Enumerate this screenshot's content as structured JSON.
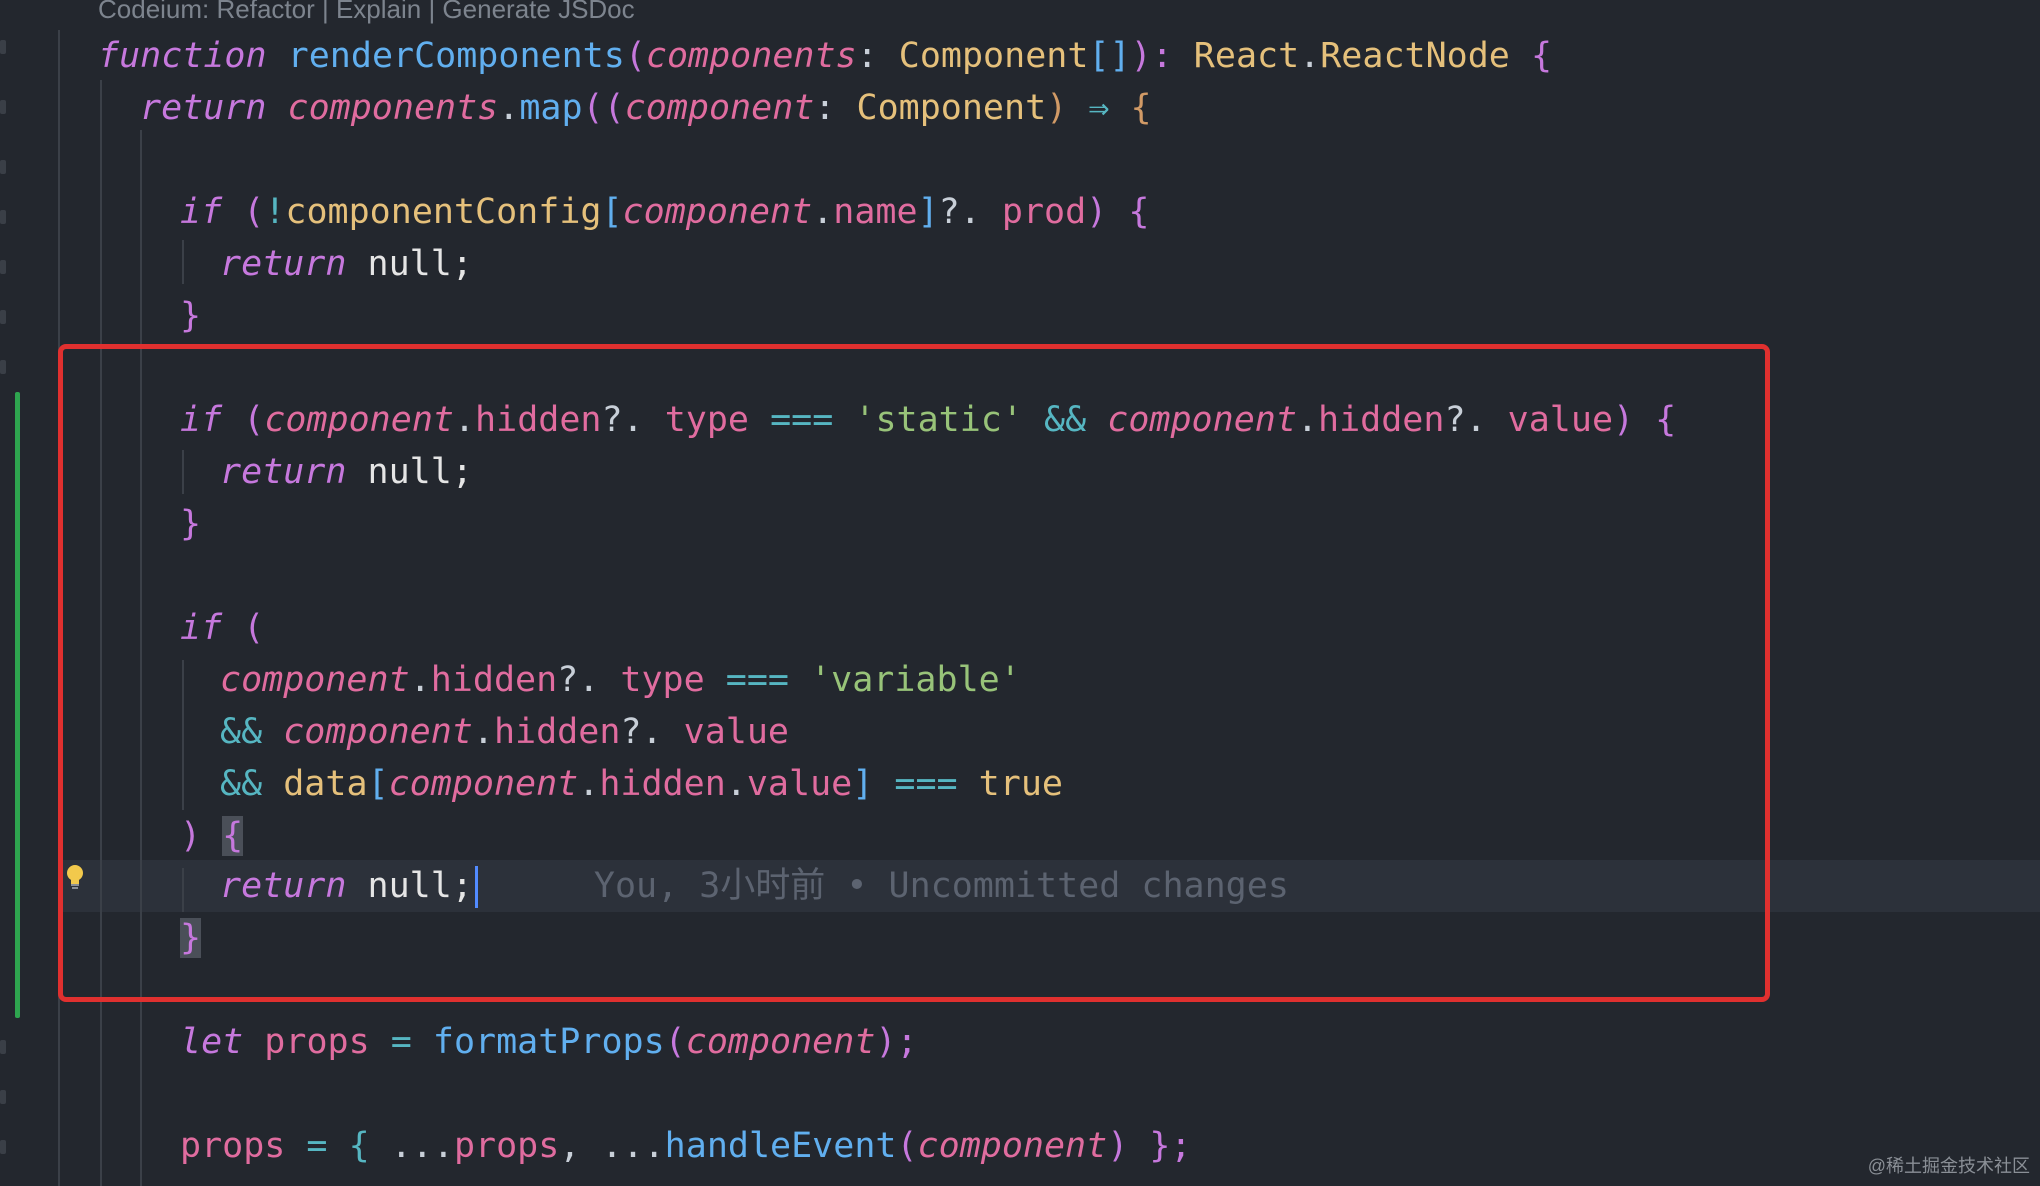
{
  "codelens": "Codeium: Refactor | Explain | Generate JSDoc",
  "blame": "You, 3小时前 • Uncommitted changes",
  "watermark": "@稀土掘金技术社区",
  "icons": {
    "lightbulb": "lightbulb-icon"
  },
  "colors": {
    "background": "#23272e",
    "highlight_box": "#e0302f",
    "change_bar": "#2ea44f",
    "caret": "#528bff"
  },
  "code": {
    "l1": [
      "function",
      "renderComponents",
      "(",
      "components",
      ": ",
      "Component",
      "[]",
      "): ",
      "React",
      ".",
      "ReactNode",
      " {"
    ],
    "l2": [
      "return",
      "components",
      ".",
      "map",
      "((",
      "component",
      ": ",
      "Component",
      ") ",
      "⇒",
      " {"
    ],
    "l4": [
      "if",
      " (",
      "!",
      "componentConfig",
      "[",
      "component",
      ".",
      "name",
      "]",
      "?.",
      " prod",
      ") {"
    ],
    "l5": [
      "return",
      " null;"
    ],
    "l6": [
      "}"
    ],
    "l8": [
      "if",
      " (",
      "component",
      ".",
      "hidden",
      "?.",
      " type",
      " ",
      "===",
      " ",
      "'static'",
      " ",
      "&&",
      " ",
      "component",
      ".",
      "hidden",
      "?.",
      " value",
      ") {"
    ],
    "l9": [
      "return",
      " null;"
    ],
    "l10": [
      "}"
    ],
    "l12": [
      "if",
      " ("
    ],
    "l13": [
      "component",
      ".",
      "hidden",
      "?.",
      " type",
      " ",
      "===",
      " ",
      "'variable'"
    ],
    "l14": [
      "&&",
      " ",
      "component",
      ".",
      "hidden",
      "?.",
      " value"
    ],
    "l15": [
      "&&",
      " ",
      "data",
      "[",
      "component",
      ".",
      "hidden",
      ".",
      "value",
      "]",
      " ",
      "===",
      " ",
      "true"
    ],
    "l16": [
      ")",
      " ",
      "{"
    ],
    "l17": [
      "return",
      " null;"
    ],
    "l18": [
      "}"
    ],
    "l20": [
      "let",
      " ",
      "props",
      " = ",
      "formatProps",
      "(",
      "component",
      ");"
    ],
    "l22": [
      "props",
      " = { ",
      "...",
      "props",
      ", ",
      "...",
      "handleEvent",
      "(",
      "component",
      ") };"
    ]
  }
}
